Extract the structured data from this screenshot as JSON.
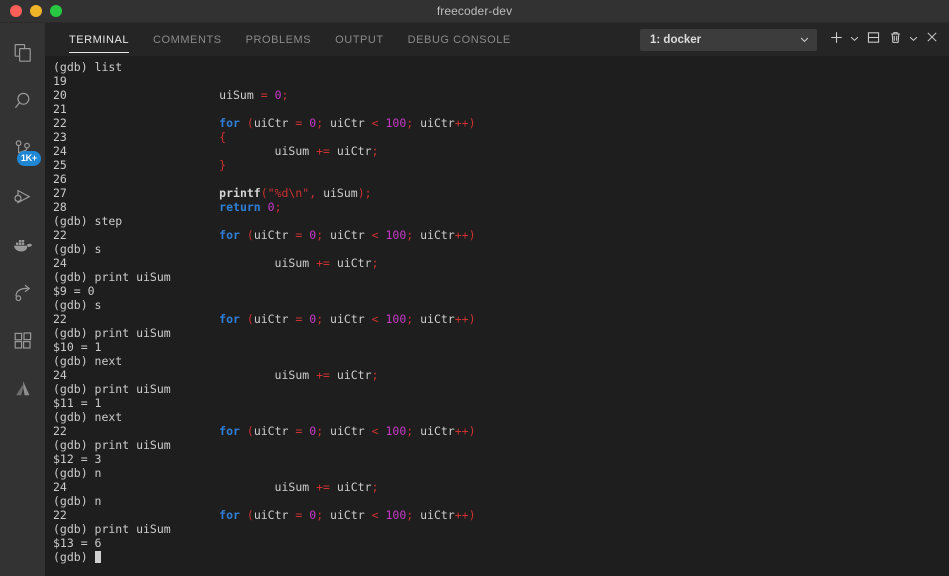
{
  "window": {
    "title": "freecoder-dev",
    "traffic_lights": [
      {
        "name": "close",
        "color": "#ff5f57"
      },
      {
        "name": "minimize",
        "color": "#f0b429"
      },
      {
        "name": "maximize",
        "color": "#28c840"
      }
    ]
  },
  "activity_bar": {
    "items": [
      {
        "name": "explorer",
        "icon": "files-icon",
        "badge": null
      },
      {
        "name": "search",
        "icon": "search-icon",
        "badge": null
      },
      {
        "name": "source-control",
        "icon": "source-control-icon",
        "badge": "1K+"
      },
      {
        "name": "run-and-debug",
        "icon": "run-debug-icon",
        "badge": null
      },
      {
        "name": "docker",
        "icon": "docker-icon",
        "badge": null
      },
      {
        "name": "remote-explorer",
        "icon": "remote-explorer-icon",
        "badge": null
      },
      {
        "name": "extensions",
        "icon": "extensions-icon",
        "badge": null
      },
      {
        "name": "atlassian",
        "icon": "atlassian-icon",
        "badge": null
      }
    ],
    "badge_color": "#1f87d3"
  },
  "panel": {
    "tabs": [
      {
        "label": "TERMINAL",
        "active": true
      },
      {
        "label": "COMMENTS",
        "active": false
      },
      {
        "label": "PROBLEMS",
        "active": false
      },
      {
        "label": "OUTPUT",
        "active": false
      },
      {
        "label": "DEBUG CONSOLE",
        "active": false
      }
    ],
    "terminal_selector": {
      "value": "1: docker",
      "chevron": "chevron-down-icon"
    },
    "toolbar": [
      {
        "name": "new-terminal-button",
        "icon": "plus-icon"
      },
      {
        "name": "new-terminal-dropdown",
        "icon": "chevron-down-icon"
      },
      {
        "name": "split-terminal-button",
        "icon": "split-panel-icon"
      },
      {
        "name": "kill-terminal-button",
        "icon": "trash-icon"
      },
      {
        "name": "panel-more-actions-button",
        "icon": "chevron-down-icon"
      },
      {
        "name": "close-panel-button",
        "icon": "close-icon"
      }
    ]
  },
  "terminal": {
    "prompt": "(gdb) ",
    "cursor_visible": true,
    "colors": {
      "background": "#1e1e1e",
      "foreground": "#cccccc",
      "keyword": "#2f7fd8",
      "number": "#c838c8",
      "operator": "#cd3131",
      "string": "#cd3131"
    },
    "lines": [
      [
        {
          "t": "(gdb) list",
          "c": "def"
        }
      ],
      [
        {
          "t": "19",
          "c": "def"
        }
      ],
      [
        {
          "t": "20\t\t\tuiSum ",
          "c": "def"
        },
        {
          "t": "=",
          "c": "op"
        },
        {
          "t": " ",
          "c": "def"
        },
        {
          "t": "0",
          "c": "num"
        },
        {
          "t": ";",
          "c": "punc"
        }
      ],
      [
        {
          "t": "21",
          "c": "def"
        }
      ],
      [
        {
          "t": "22\t\t\t",
          "c": "def"
        },
        {
          "t": "for",
          "c": "kw"
        },
        {
          "t": " ",
          "c": "def"
        },
        {
          "t": "(",
          "c": "punc"
        },
        {
          "t": "uiCtr ",
          "c": "def"
        },
        {
          "t": "=",
          "c": "op"
        },
        {
          "t": " ",
          "c": "def"
        },
        {
          "t": "0",
          "c": "num"
        },
        {
          "t": ";",
          "c": "punc"
        },
        {
          "t": " uiCtr ",
          "c": "def"
        },
        {
          "t": "<",
          "c": "op"
        },
        {
          "t": " ",
          "c": "def"
        },
        {
          "t": "100",
          "c": "num"
        },
        {
          "t": ";",
          "c": "punc"
        },
        {
          "t": " uiCtr",
          "c": "def"
        },
        {
          "t": "++)",
          "c": "op"
        }
      ],
      [
        {
          "t": "23\t\t\t",
          "c": "def"
        },
        {
          "t": "{",
          "c": "punc"
        }
      ],
      [
        {
          "t": "24\t\t\t\tuiSum ",
          "c": "def"
        },
        {
          "t": "+=",
          "c": "op"
        },
        {
          "t": " uiCtr",
          "c": "def"
        },
        {
          "t": ";",
          "c": "punc"
        }
      ],
      [
        {
          "t": "25\t\t\t",
          "c": "def"
        },
        {
          "t": "}",
          "c": "punc"
        }
      ],
      [
        {
          "t": "26",
          "c": "def"
        }
      ],
      [
        {
          "t": "27\t\t\t",
          "c": "def"
        },
        {
          "t": "printf",
          "c": "fn"
        },
        {
          "t": "(",
          "c": "punc"
        },
        {
          "t": "\"%d\\n\"",
          "c": "str"
        },
        {
          "t": ",",
          "c": "punc"
        },
        {
          "t": " uiSum",
          "c": "def"
        },
        {
          "t": ");",
          "c": "punc"
        }
      ],
      [
        {
          "t": "28\t\t\t",
          "c": "def"
        },
        {
          "t": "return",
          "c": "kw"
        },
        {
          "t": " ",
          "c": "def"
        },
        {
          "t": "0",
          "c": "num"
        },
        {
          "t": ";",
          "c": "punc"
        }
      ],
      [
        {
          "t": "(gdb) step",
          "c": "def"
        }
      ],
      [
        {
          "t": "22\t\t\t",
          "c": "def"
        },
        {
          "t": "for",
          "c": "kw"
        },
        {
          "t": " ",
          "c": "def"
        },
        {
          "t": "(",
          "c": "punc"
        },
        {
          "t": "uiCtr ",
          "c": "def"
        },
        {
          "t": "=",
          "c": "op"
        },
        {
          "t": " ",
          "c": "def"
        },
        {
          "t": "0",
          "c": "num"
        },
        {
          "t": ";",
          "c": "punc"
        },
        {
          "t": " uiCtr ",
          "c": "def"
        },
        {
          "t": "<",
          "c": "op"
        },
        {
          "t": " ",
          "c": "def"
        },
        {
          "t": "100",
          "c": "num"
        },
        {
          "t": ";",
          "c": "punc"
        },
        {
          "t": " uiCtr",
          "c": "def"
        },
        {
          "t": "++)",
          "c": "op"
        }
      ],
      [
        {
          "t": "(gdb) s",
          "c": "def"
        }
      ],
      [
        {
          "t": "24\t\t\t\tuiSum ",
          "c": "def"
        },
        {
          "t": "+=",
          "c": "op"
        },
        {
          "t": " uiCtr",
          "c": "def"
        },
        {
          "t": ";",
          "c": "punc"
        }
      ],
      [
        {
          "t": "(gdb) print uiSum",
          "c": "def"
        }
      ],
      [
        {
          "t": "$9 = 0",
          "c": "def"
        }
      ],
      [
        {
          "t": "(gdb) s",
          "c": "def"
        }
      ],
      [
        {
          "t": "22\t\t\t",
          "c": "def"
        },
        {
          "t": "for",
          "c": "kw"
        },
        {
          "t": " ",
          "c": "def"
        },
        {
          "t": "(",
          "c": "punc"
        },
        {
          "t": "uiCtr ",
          "c": "def"
        },
        {
          "t": "=",
          "c": "op"
        },
        {
          "t": " ",
          "c": "def"
        },
        {
          "t": "0",
          "c": "num"
        },
        {
          "t": ";",
          "c": "punc"
        },
        {
          "t": " uiCtr ",
          "c": "def"
        },
        {
          "t": "<",
          "c": "op"
        },
        {
          "t": " ",
          "c": "def"
        },
        {
          "t": "100",
          "c": "num"
        },
        {
          "t": ";",
          "c": "punc"
        },
        {
          "t": " uiCtr",
          "c": "def"
        },
        {
          "t": "++)",
          "c": "op"
        }
      ],
      [
        {
          "t": "(gdb) print uiSum",
          "c": "def"
        }
      ],
      [
        {
          "t": "$10 = 1",
          "c": "def"
        }
      ],
      [
        {
          "t": "(gdb) next",
          "c": "def"
        }
      ],
      [
        {
          "t": "24\t\t\t\tuiSum ",
          "c": "def"
        },
        {
          "t": "+=",
          "c": "op"
        },
        {
          "t": " uiCtr",
          "c": "def"
        },
        {
          "t": ";",
          "c": "punc"
        }
      ],
      [
        {
          "t": "(gdb) print uiSum",
          "c": "def"
        }
      ],
      [
        {
          "t": "$11 = 1",
          "c": "def"
        }
      ],
      [
        {
          "t": "(gdb) next",
          "c": "def"
        }
      ],
      [
        {
          "t": "22\t\t\t",
          "c": "def"
        },
        {
          "t": "for",
          "c": "kw"
        },
        {
          "t": " ",
          "c": "def"
        },
        {
          "t": "(",
          "c": "punc"
        },
        {
          "t": "uiCtr ",
          "c": "def"
        },
        {
          "t": "=",
          "c": "op"
        },
        {
          "t": " ",
          "c": "def"
        },
        {
          "t": "0",
          "c": "num"
        },
        {
          "t": ";",
          "c": "punc"
        },
        {
          "t": " uiCtr ",
          "c": "def"
        },
        {
          "t": "<",
          "c": "op"
        },
        {
          "t": " ",
          "c": "def"
        },
        {
          "t": "100",
          "c": "num"
        },
        {
          "t": ";",
          "c": "punc"
        },
        {
          "t": " uiCtr",
          "c": "def"
        },
        {
          "t": "++)",
          "c": "op"
        }
      ],
      [
        {
          "t": "(gdb) print uiSum",
          "c": "def"
        }
      ],
      [
        {
          "t": "$12 = 3",
          "c": "def"
        }
      ],
      [
        {
          "t": "(gdb) n",
          "c": "def"
        }
      ],
      [
        {
          "t": "24\t\t\t\tuiSum ",
          "c": "def"
        },
        {
          "t": "+=",
          "c": "op"
        },
        {
          "t": " uiCtr",
          "c": "def"
        },
        {
          "t": ";",
          "c": "punc"
        }
      ],
      [
        {
          "t": "(gdb) n",
          "c": "def"
        }
      ],
      [
        {
          "t": "22\t\t\t",
          "c": "def"
        },
        {
          "t": "for",
          "c": "kw"
        },
        {
          "t": " ",
          "c": "def"
        },
        {
          "t": "(",
          "c": "punc"
        },
        {
          "t": "uiCtr ",
          "c": "def"
        },
        {
          "t": "=",
          "c": "op"
        },
        {
          "t": " ",
          "c": "def"
        },
        {
          "t": "0",
          "c": "num"
        },
        {
          "t": ";",
          "c": "punc"
        },
        {
          "t": " uiCtr ",
          "c": "def"
        },
        {
          "t": "<",
          "c": "op"
        },
        {
          "t": " ",
          "c": "def"
        },
        {
          "t": "100",
          "c": "num"
        },
        {
          "t": ";",
          "c": "punc"
        },
        {
          "t": " uiCtr",
          "c": "def"
        },
        {
          "t": "++)",
          "c": "op"
        }
      ],
      [
        {
          "t": "(gdb) print uiSum",
          "c": "def"
        }
      ],
      [
        {
          "t": "$13 = 6",
          "c": "def"
        }
      ],
      [
        {
          "t": "(gdb) ",
          "c": "def",
          "cursor": true
        }
      ]
    ]
  }
}
